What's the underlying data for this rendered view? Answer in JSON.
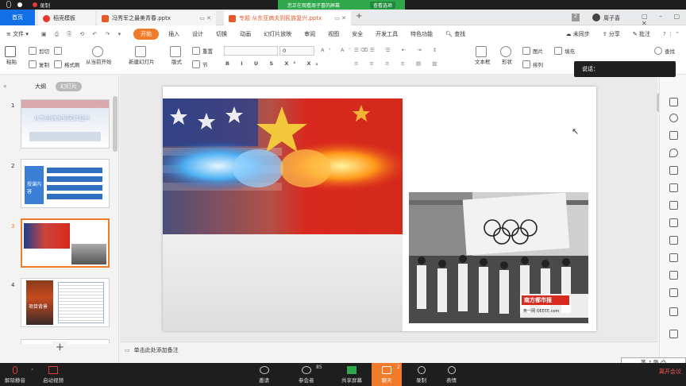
{
  "topbar": {
    "recording_label": "录制"
  },
  "banner": {
    "text": "您正在观看周子喜的屏幕",
    "view_label": "查看选项"
  },
  "tabs": [
    {
      "label": "首页"
    },
    {
      "label": "稻壳模板"
    },
    {
      "label": "冯秀军之最美青春.pptx"
    },
    {
      "label": "专题 从东亚病夫到民族复兴.pptx"
    }
  ],
  "tab_counter": "2",
  "user_name": "周子喜",
  "menu": {
    "file": "文件",
    "start": "开始",
    "items": [
      "插入",
      "设计",
      "切换",
      "动画",
      "幻灯片放映",
      "审阅",
      "视图",
      "安全",
      "开发工具",
      "特色功能"
    ],
    "search": "查找",
    "sync": "未同步",
    "share": "分享",
    "comment": "批注"
  },
  "ribbon": {
    "paste": "粘贴",
    "cut": "剪切",
    "copy": "复制",
    "format_painter": "格式刷",
    "from_current": "从当前开始",
    "new_slide": "新建幻灯片",
    "layout": "版式",
    "reset": "重置",
    "section": "节",
    "font_size": "0",
    "textbox": "文本框",
    "shape": "形状",
    "picture": "图片",
    "fill": "填充",
    "arrange": "排列",
    "find": "查找"
  },
  "left_panel": {
    "outline_tab": "大纲",
    "slides_tab": "幻灯片",
    "numbers": [
      "1",
      "2",
      "3",
      "4"
    ],
    "thumb1_title": "从东亚病夫到民族复兴",
    "thumb2_title": "授课内容",
    "thumb4_title": "项目背景"
  },
  "slide": {
    "image_caption": "南方都市报",
    "image_sub": "奥一网 OEEEE.com"
  },
  "notes_placeholder": "单击此处添加备注",
  "tooltip": "说话：",
  "status": {
    "mute": "解除静音",
    "video": "启动视频",
    "invite": "邀请",
    "participants": "参会者",
    "participant_count": "85",
    "share_screen": "共享屏幕",
    "chat": "聊天",
    "chat_count": "2",
    "record": "录制",
    "apps": "表情",
    "leave": "离开会议"
  },
  "ime": "英 ♪ 简 ☺"
}
